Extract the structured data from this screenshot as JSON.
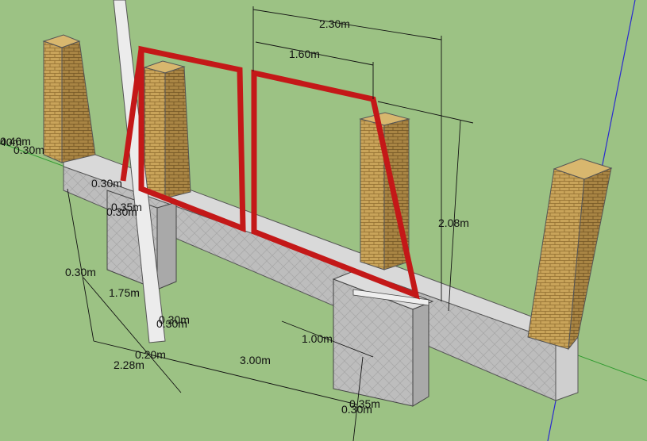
{
  "scene": {
    "background": "#9cc284",
    "colors": {
      "gate_frame": "#c41818",
      "brick": "#c9a45a",
      "concrete_light": "#d6d6d6",
      "concrete_mid": "#bdbdbd",
      "concrete_dark": "#a9a9a9",
      "post": "#e9e9e9",
      "axis_green": "#2e9a2e",
      "axis_blue": "#2a2ad0",
      "dimension_line": "#111111"
    }
  },
  "dimensions": {
    "overall_width": "2.30m",
    "leaf_width": "1.60m",
    "gate_height": "2.08m",
    "footing_width": "1.00m",
    "span": "3.00m",
    "left_total": "2.28m",
    "left_depth": "1.75m",
    "left_small_a": "0.30m",
    "left_small_b": "0.30m",
    "left_small_c": "0.30m",
    "left_small_d": "0.30m",
    "left_small_e": "0.30m",
    "left_small_f": "0.20m",
    "left_small_g": "0.35m",
    "left_small_h": "0.30m",
    "left_small_i": "0.40m",
    "bottom_small_a": "0.35m",
    "bottom_small_b": "0.30m",
    "edge_label": "40m"
  }
}
